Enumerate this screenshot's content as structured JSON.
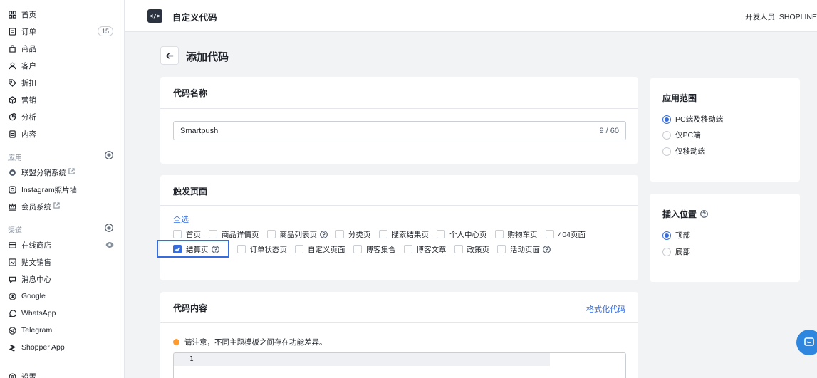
{
  "sidebar": {
    "items": [
      {
        "label": "首页",
        "icon": "home-icon"
      },
      {
        "label": "订单",
        "icon": "order-icon",
        "badge": "15"
      },
      {
        "label": "商品",
        "icon": "bag-icon"
      },
      {
        "label": "客户",
        "icon": "user-icon"
      },
      {
        "label": "折扣",
        "icon": "tag-icon"
      },
      {
        "label": "营销",
        "icon": "cube-icon"
      },
      {
        "label": "分析",
        "icon": "pie-icon"
      },
      {
        "label": "内容",
        "icon": "doc-icon"
      }
    ],
    "apps_label": "应用",
    "apps": [
      {
        "label": "联盟分销系统",
        "icon": "affiliate-icon",
        "external": true
      },
      {
        "label": "Instagram照片墙",
        "icon": "instagram-icon",
        "external": false
      },
      {
        "label": "会员系统",
        "icon": "crown-icon",
        "external": true
      }
    ],
    "channels_label": "渠道",
    "channels": [
      {
        "label": "在线商店",
        "icon": "store-icon"
      },
      {
        "label": "贴文销售",
        "icon": "post-icon"
      },
      {
        "label": "消息中心",
        "icon": "message-icon"
      },
      {
        "label": "Google",
        "icon": "google-icon"
      },
      {
        "label": "WhatsApp",
        "icon": "whatsapp-icon"
      },
      {
        "label": "Telegram",
        "icon": "telegram-icon"
      },
      {
        "label": "Shopper App",
        "icon": "shopper-icon"
      }
    ],
    "settings_label": "设置"
  },
  "header": {
    "title": "自定义代码",
    "developer": "开发人员: SHOPLINE"
  },
  "page": {
    "title": "添加代码"
  },
  "code_name": {
    "title": "代码名称",
    "value": "Smartpush",
    "counter": "9 / 60"
  },
  "trigger": {
    "title": "触发页面",
    "select_all": "全选",
    "row1": [
      {
        "label": "首页",
        "checked": false,
        "help": false
      },
      {
        "label": "商品详情页",
        "checked": false,
        "help": false
      },
      {
        "label": "商品列表页",
        "checked": false,
        "help": true
      },
      {
        "label": "分类页",
        "checked": false,
        "help": false
      },
      {
        "label": "搜索结果页",
        "checked": false,
        "help": false
      },
      {
        "label": "个人中心页",
        "checked": false,
        "help": false
      },
      {
        "label": "购物车页",
        "checked": false,
        "help": false
      },
      {
        "label": "404页面",
        "checked": false,
        "help": false
      }
    ],
    "row2": [
      {
        "label": "结算页",
        "checked": true,
        "help": true
      },
      {
        "label": "订单状态页",
        "checked": false,
        "help": false
      },
      {
        "label": "自定义页面",
        "checked": false,
        "help": false
      },
      {
        "label": "博客集合",
        "checked": false,
        "help": false
      },
      {
        "label": "博客文章",
        "checked": false,
        "help": false
      },
      {
        "label": "政策页",
        "checked": false,
        "help": false
      },
      {
        "label": "活动页面",
        "checked": false,
        "help": true
      }
    ]
  },
  "code_content": {
    "title": "代码内容",
    "format_label": "格式化代码",
    "notice": "请注意，不同主题模板之间存在功能差异。",
    "line_number": "1"
  },
  "scope": {
    "title": "应用范围",
    "options": [
      {
        "label": "PC端及移动端",
        "selected": true
      },
      {
        "label": "仅PC端",
        "selected": false
      },
      {
        "label": "仅移动端",
        "selected": false
      }
    ]
  },
  "position": {
    "title": "插入位置",
    "options": [
      {
        "label": "顶部",
        "selected": true
      },
      {
        "label": "底部",
        "selected": false
      }
    ]
  },
  "colors": {
    "primary": "#356dde",
    "notice_dot": "#ff9a2e",
    "chat": "#2e86de"
  }
}
